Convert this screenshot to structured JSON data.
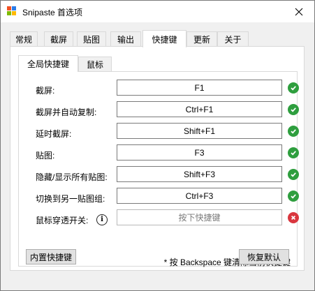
{
  "window": {
    "title": "Snipaste 首选项"
  },
  "tabs": [
    "常规",
    "截屏",
    "贴图",
    "输出",
    "快捷键",
    "更新",
    "关于"
  ],
  "active_tab": "快捷键",
  "subtabs": [
    "全局快捷键",
    "鼠标"
  ],
  "active_subtab": "全局快捷键",
  "hotkeys": [
    {
      "label": "截屏:",
      "value": "F1",
      "status": "ok"
    },
    {
      "label": "截屏并自动复制:",
      "value": "Ctrl+F1",
      "status": "ok"
    },
    {
      "label": "延时截屏:",
      "value": "Shift+F1",
      "status": "ok"
    },
    {
      "label": "贴图:",
      "value": "F3",
      "status": "ok"
    },
    {
      "label": "隐藏/显示所有贴图:",
      "value": "Shift+F3",
      "status": "ok"
    },
    {
      "label": "切换到另一贴图组:",
      "value": "Ctrl+F3",
      "status": "ok"
    },
    {
      "label": "鼠标穿透开关:",
      "value": "",
      "placeholder": "按下快捷键",
      "status": "error"
    }
  ],
  "note": "* 按 Backspace 键清除当前快捷键",
  "buttons": {
    "builtin": "内置快捷键",
    "restore": "恢复默认"
  }
}
